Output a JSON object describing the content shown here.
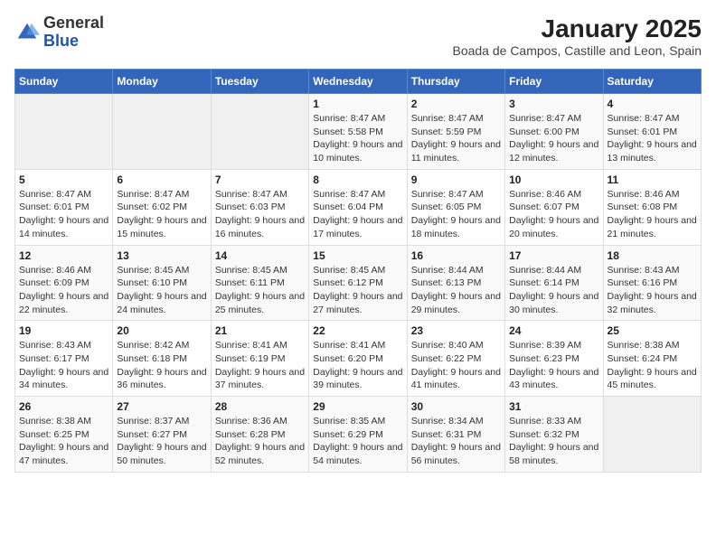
{
  "header": {
    "logo_line1": "General",
    "logo_line2": "Blue",
    "title": "January 2025",
    "subtitle": "Boada de Campos, Castille and Leon, Spain"
  },
  "weekdays": [
    "Sunday",
    "Monday",
    "Tuesday",
    "Wednesday",
    "Thursday",
    "Friday",
    "Saturday"
  ],
  "weeks": [
    [
      {
        "day": "",
        "detail": ""
      },
      {
        "day": "",
        "detail": ""
      },
      {
        "day": "",
        "detail": ""
      },
      {
        "day": "1",
        "detail": "Sunrise: 8:47 AM\nSunset: 5:58 PM\nDaylight: 9 hours and 10 minutes."
      },
      {
        "day": "2",
        "detail": "Sunrise: 8:47 AM\nSunset: 5:59 PM\nDaylight: 9 hours and 11 minutes."
      },
      {
        "day": "3",
        "detail": "Sunrise: 8:47 AM\nSunset: 6:00 PM\nDaylight: 9 hours and 12 minutes."
      },
      {
        "day": "4",
        "detail": "Sunrise: 8:47 AM\nSunset: 6:01 PM\nDaylight: 9 hours and 13 minutes."
      }
    ],
    [
      {
        "day": "5",
        "detail": "Sunrise: 8:47 AM\nSunset: 6:01 PM\nDaylight: 9 hours and 14 minutes."
      },
      {
        "day": "6",
        "detail": "Sunrise: 8:47 AM\nSunset: 6:02 PM\nDaylight: 9 hours and 15 minutes."
      },
      {
        "day": "7",
        "detail": "Sunrise: 8:47 AM\nSunset: 6:03 PM\nDaylight: 9 hours and 16 minutes."
      },
      {
        "day": "8",
        "detail": "Sunrise: 8:47 AM\nSunset: 6:04 PM\nDaylight: 9 hours and 17 minutes."
      },
      {
        "day": "9",
        "detail": "Sunrise: 8:47 AM\nSunset: 6:05 PM\nDaylight: 9 hours and 18 minutes."
      },
      {
        "day": "10",
        "detail": "Sunrise: 8:46 AM\nSunset: 6:07 PM\nDaylight: 9 hours and 20 minutes."
      },
      {
        "day": "11",
        "detail": "Sunrise: 8:46 AM\nSunset: 6:08 PM\nDaylight: 9 hours and 21 minutes."
      }
    ],
    [
      {
        "day": "12",
        "detail": "Sunrise: 8:46 AM\nSunset: 6:09 PM\nDaylight: 9 hours and 22 minutes."
      },
      {
        "day": "13",
        "detail": "Sunrise: 8:45 AM\nSunset: 6:10 PM\nDaylight: 9 hours and 24 minutes."
      },
      {
        "day": "14",
        "detail": "Sunrise: 8:45 AM\nSunset: 6:11 PM\nDaylight: 9 hours and 25 minutes."
      },
      {
        "day": "15",
        "detail": "Sunrise: 8:45 AM\nSunset: 6:12 PM\nDaylight: 9 hours and 27 minutes."
      },
      {
        "day": "16",
        "detail": "Sunrise: 8:44 AM\nSunset: 6:13 PM\nDaylight: 9 hours and 29 minutes."
      },
      {
        "day": "17",
        "detail": "Sunrise: 8:44 AM\nSunset: 6:14 PM\nDaylight: 9 hours and 30 minutes."
      },
      {
        "day": "18",
        "detail": "Sunrise: 8:43 AM\nSunset: 6:16 PM\nDaylight: 9 hours and 32 minutes."
      }
    ],
    [
      {
        "day": "19",
        "detail": "Sunrise: 8:43 AM\nSunset: 6:17 PM\nDaylight: 9 hours and 34 minutes."
      },
      {
        "day": "20",
        "detail": "Sunrise: 8:42 AM\nSunset: 6:18 PM\nDaylight: 9 hours and 36 minutes."
      },
      {
        "day": "21",
        "detail": "Sunrise: 8:41 AM\nSunset: 6:19 PM\nDaylight: 9 hours and 37 minutes."
      },
      {
        "day": "22",
        "detail": "Sunrise: 8:41 AM\nSunset: 6:20 PM\nDaylight: 9 hours and 39 minutes."
      },
      {
        "day": "23",
        "detail": "Sunrise: 8:40 AM\nSunset: 6:22 PM\nDaylight: 9 hours and 41 minutes."
      },
      {
        "day": "24",
        "detail": "Sunrise: 8:39 AM\nSunset: 6:23 PM\nDaylight: 9 hours and 43 minutes."
      },
      {
        "day": "25",
        "detail": "Sunrise: 8:38 AM\nSunset: 6:24 PM\nDaylight: 9 hours and 45 minutes."
      }
    ],
    [
      {
        "day": "26",
        "detail": "Sunrise: 8:38 AM\nSunset: 6:25 PM\nDaylight: 9 hours and 47 minutes."
      },
      {
        "day": "27",
        "detail": "Sunrise: 8:37 AM\nSunset: 6:27 PM\nDaylight: 9 hours and 50 minutes."
      },
      {
        "day": "28",
        "detail": "Sunrise: 8:36 AM\nSunset: 6:28 PM\nDaylight: 9 hours and 52 minutes."
      },
      {
        "day": "29",
        "detail": "Sunrise: 8:35 AM\nSunset: 6:29 PM\nDaylight: 9 hours and 54 minutes."
      },
      {
        "day": "30",
        "detail": "Sunrise: 8:34 AM\nSunset: 6:31 PM\nDaylight: 9 hours and 56 minutes."
      },
      {
        "day": "31",
        "detail": "Sunrise: 8:33 AM\nSunset: 6:32 PM\nDaylight: 9 hours and 58 minutes."
      },
      {
        "day": "",
        "detail": ""
      }
    ]
  ]
}
